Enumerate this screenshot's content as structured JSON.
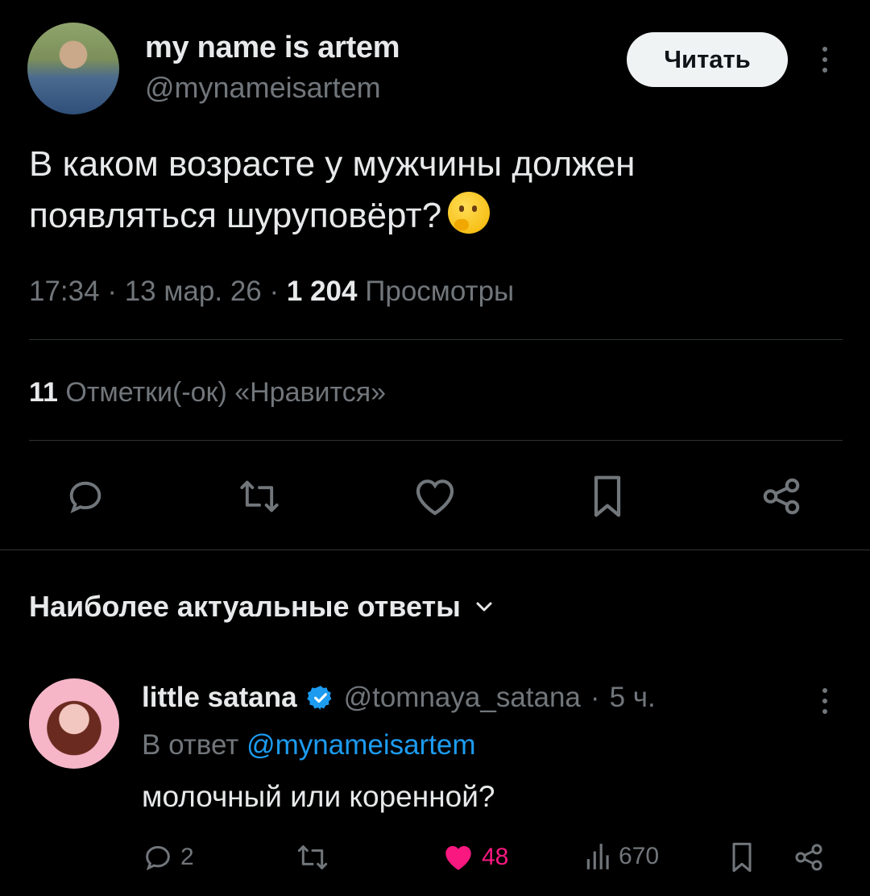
{
  "post": {
    "author": {
      "name": "my name is artem",
      "handle": "@mynameisartem"
    },
    "follow_label": "Читать",
    "text_line1": "В каком возрасте у мужчины должен",
    "text_line2": "появляться шуруповёрт?",
    "emoji": "thinking-face",
    "time": "17:34",
    "date": "13 мар. 26",
    "views_count": "1 204",
    "views_label": "Просмотры",
    "likes_count": "11",
    "likes_label": "Отметки(-ок) «Нравится»",
    "actions": [
      "reply-icon",
      "repost-icon",
      "like-icon",
      "bookmark-icon",
      "share-icon"
    ]
  },
  "replies_section": {
    "title": "Наиболее актуальные ответы"
  },
  "reply": {
    "name": "little satana",
    "verified": true,
    "handle": "@tomnaya_satana",
    "age": "5 ч.",
    "in_reply_prefix": "В ответ",
    "in_reply_handle": "@mynameisartem",
    "text": "молочный или коренной?",
    "stats": {
      "replies": "2",
      "likes": "48",
      "views": "670"
    }
  },
  "colors": {
    "background": "#000000",
    "text": "#e7e9ea",
    "secondary": "#71767b",
    "link": "#1d9bf0",
    "like_active": "#f91880",
    "divider": "#2f3336"
  }
}
